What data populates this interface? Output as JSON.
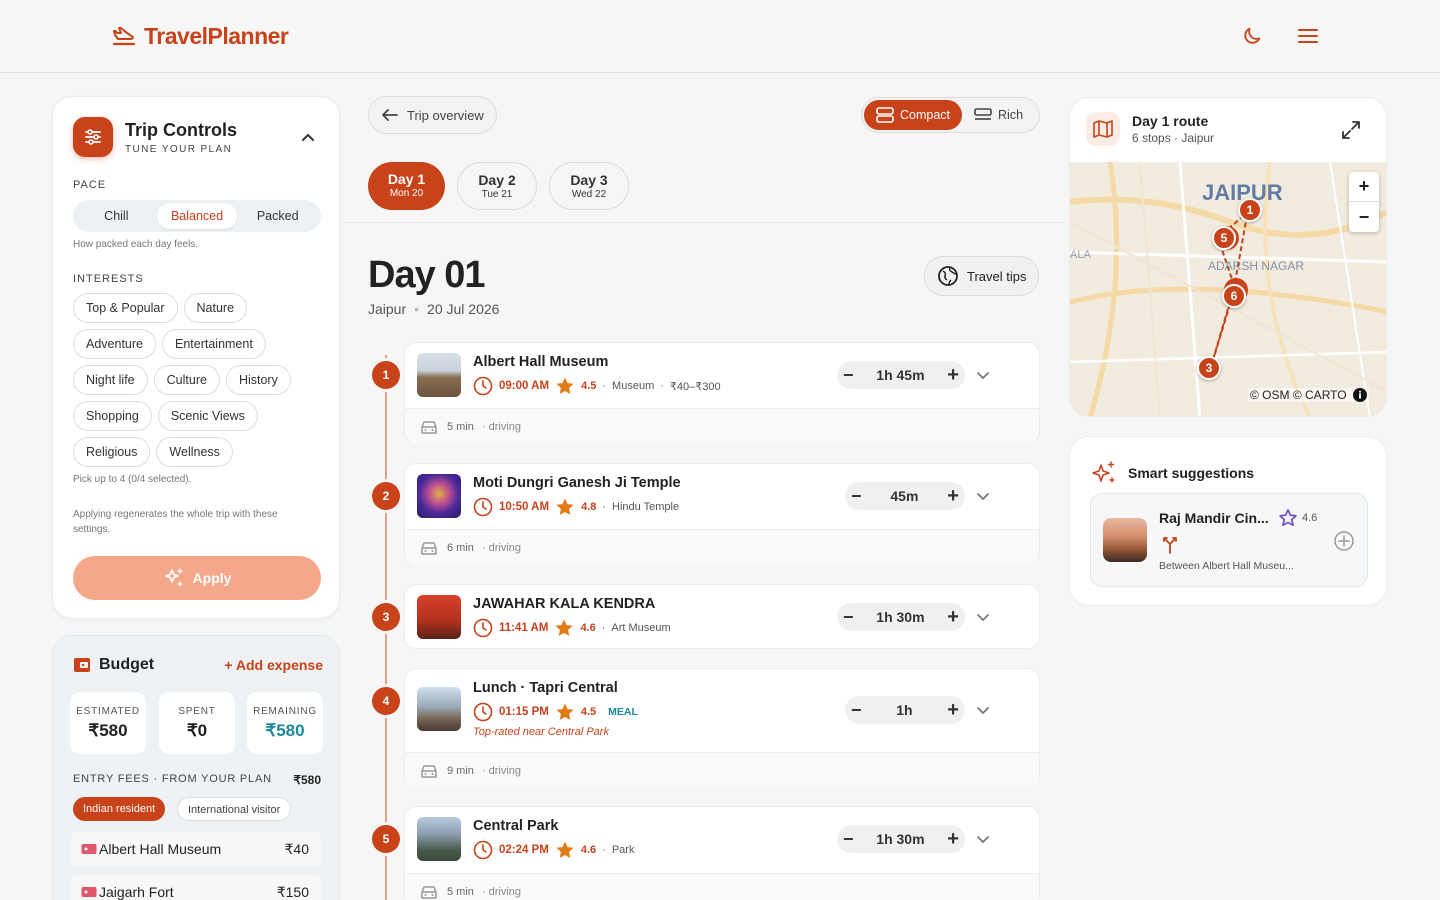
{
  "app": {
    "name": "TravelPlanner"
  },
  "trip_controls": {
    "title": "Trip Controls",
    "subtitle": "TUNE YOUR PLAN",
    "pace_label": "PACE",
    "pace_options": [
      "Chill",
      "Balanced",
      "Packed"
    ],
    "pace_selected": "Balanced",
    "pace_hint": "How packed each day feels.",
    "interests_label": "INTERESTS",
    "interests": [
      "Top & Popular",
      "Nature",
      "Adventure",
      "Entertainment",
      "Night life",
      "Culture",
      "History",
      "Shopping",
      "Scenic Views",
      "Religious",
      "Wellness"
    ],
    "interests_hint": "Pick up to 4 (0/4 selected).",
    "apply_hint": "Applying regenerates the whole trip with these settings.",
    "apply_label": "Apply"
  },
  "budget": {
    "title": "Budget",
    "add_expense": "+ Add expense",
    "stats": [
      {
        "label": "ESTIMATED",
        "value": "₹580"
      },
      {
        "label": "SPENT",
        "value": "₹0"
      },
      {
        "label": "REMAINING",
        "value": "₹580"
      }
    ],
    "entry_fees_label": "ENTRY FEES · FROM YOUR PLAN",
    "entry_fees_total": "₹580",
    "visitor_types": [
      "Indian resident",
      "International visitor"
    ],
    "visitor_selected": "Indian resident",
    "fees": [
      {
        "name": "Albert Hall Museum",
        "amount": "₹40"
      },
      {
        "name": "Jaigarh Fort",
        "amount": "₹150"
      }
    ]
  },
  "itinerary": {
    "back_label": "Trip overview",
    "view_modes": [
      "Compact",
      "Rich"
    ],
    "view_selected": "Compact",
    "days": [
      {
        "label": "Day 1",
        "date": "Mon 20"
      },
      {
        "label": "Day 2",
        "date": "Tue 21"
      },
      {
        "label": "Day 3",
        "date": "Wed 22"
      }
    ],
    "selected_day": "Day 1",
    "day_title": "Day 01",
    "city": "Jaipur",
    "date": "20 Jul 2026",
    "travel_tips": "Travel tips",
    "stops": [
      {
        "num": "1",
        "name": "Albert Hall Museum",
        "time": "09:00 AM",
        "rating": "4.5",
        "category": "Museum",
        "price": "₹40–₹300",
        "duration": "1h 45m",
        "drive_time": "5 min",
        "drive_mode": "· driving"
      },
      {
        "num": "2",
        "name": "Moti Dungri Ganesh Ji Temple",
        "time": "10:50 AM",
        "rating": "4.8",
        "category": "Hindu Temple",
        "duration": "45m",
        "drive_time": "6 min",
        "drive_mode": "· driving"
      },
      {
        "num": "3",
        "name": "JAWAHAR KALA KENDRA",
        "time": "11:41 AM",
        "rating": "4.6",
        "category": "Art Museum",
        "duration": "1h 30m"
      },
      {
        "num": "4",
        "name": "Lunch · Tapri Central",
        "time": "01:15 PM",
        "rating": "4.5",
        "tag": "MEAL",
        "note": "Top-rated near Central Park",
        "duration": "1h",
        "drive_time": "9 min",
        "drive_mode": "· driving"
      },
      {
        "num": "5",
        "name": "Central Park",
        "time": "02:24 PM",
        "rating": "4.6",
        "category": "Park",
        "duration": "1h 30m",
        "drive_time": "5 min",
        "drive_mode": "· driving"
      }
    ]
  },
  "map": {
    "title": "Day 1 route",
    "subtitle": "6 stops · Jaipur",
    "city_label": "JAIPUR",
    "area_label": "ADARSH NAGAR",
    "edge_label": "ALA",
    "attribution": "© OSM © CARTO",
    "zoom_in": "+",
    "zoom_out": "−",
    "markers": [
      "1",
      "5",
      "6",
      "3"
    ]
  },
  "suggestions": {
    "title": "Smart suggestions",
    "items": [
      {
        "name": "Raj Mandir Cin...",
        "rating": "4.6",
        "note": "Between Albert Hall Museu..."
      }
    ]
  },
  "colors": {
    "accent": "#c8421a",
    "accent_light": "#f5a889",
    "teal": "#1a8a9a",
    "purple": "#6a4bc4"
  }
}
